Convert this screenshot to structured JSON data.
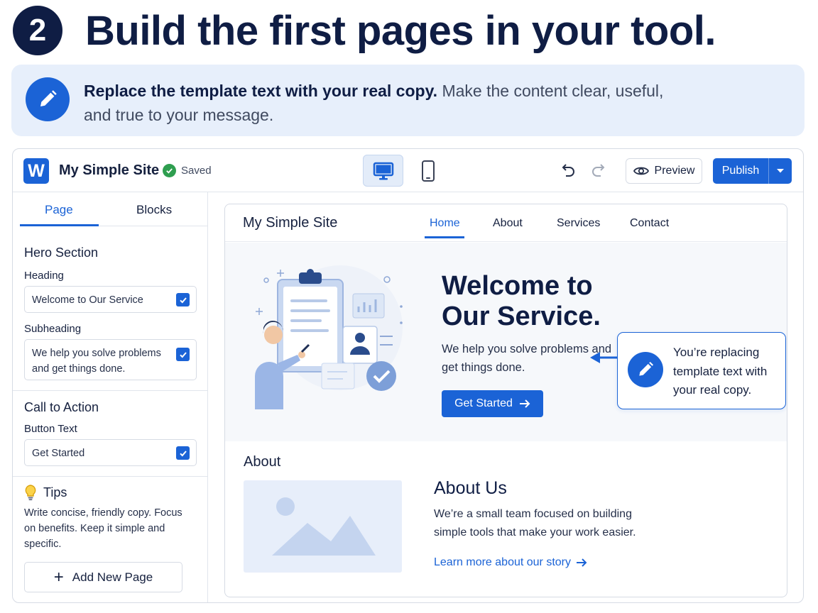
{
  "step": {
    "number": "2",
    "title": "Build the first pages in your tool."
  },
  "banner": {
    "bold": "Replace the template text with your real copy.",
    "text": " Make the content clear, useful, and true to your message.",
    "icon": "pencil-icon"
  },
  "editor": {
    "logo": "W",
    "site_name": "My Simple Site",
    "saved_label": "Saved",
    "preview_label": "Preview",
    "publish_label": "Publish",
    "accent_color": "#1b63d6"
  },
  "sidebar": {
    "tabs": [
      {
        "label": "Page",
        "active": true
      },
      {
        "label": "Blocks",
        "active": false
      }
    ],
    "hero_section": {
      "title": "Hero Section",
      "heading_label": "Heading",
      "heading_value": "Welcome to Our Service",
      "subheading_label": "Subheading",
      "subheading_value": "We help you solve problems and get things done."
    },
    "cta_section": {
      "title": "Call to Action",
      "button_text_label": "Button Text",
      "button_text_value": "Get Started"
    },
    "tips": {
      "title": "Tips",
      "text": "Write concise, friendly copy. Focus on benefits. Keep it simple and specific."
    },
    "add_page_label": "Add New Page"
  },
  "site": {
    "brand": "My Simple Site",
    "nav": [
      {
        "label": "Home",
        "active": true
      },
      {
        "label": "About",
        "active": false
      },
      {
        "label": "Services",
        "active": false
      },
      {
        "label": "Contact",
        "active": false
      }
    ],
    "hero": {
      "title": "Welcome to Our Service.",
      "subtitle": "We help you solve problems and get things done.",
      "cta": "Get Started"
    },
    "callout": "You’re replacing template text with your real copy.",
    "about": {
      "section_label": "About",
      "title": "About Us",
      "text": "We’re a small team focused on building simple tools that make your work easier.",
      "link": "Learn more about our story"
    }
  }
}
